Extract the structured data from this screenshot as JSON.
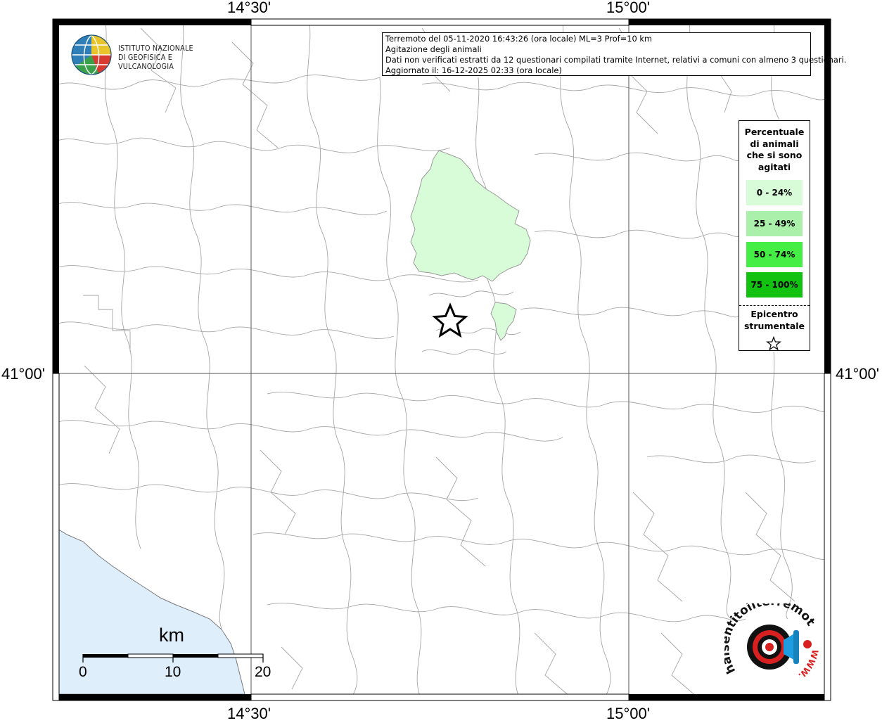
{
  "map": {
    "top_labels": [
      "14°30'",
      "15°00'"
    ],
    "bottom_labels": [
      "14°30'",
      "15°00'"
    ],
    "left_label": "41°00'",
    "right_label": "41°00'",
    "colors": {
      "land": "#ffffff",
      "sea": "#dfeefb",
      "boundary": "#a0a0a0",
      "class_0_24": "#d8fbd8",
      "class_25_49": "#aaf0aa",
      "class_50_74": "#44ee44",
      "class_75_100": "#11c211"
    }
  },
  "title_box": {
    "line1": "Terremoto del 05-11-2020 16:43:26 (ora locale) ML=3 Prof=10 km",
    "line2": "Agitazione degli animali",
    "line3": "Dati non verificati estratti da 12 questionari compilati tramite Internet, relativi a comuni con almeno 3 questionari.",
    "line4": "Aggiornato il: 16-12-2025 02:33 (ora locale)"
  },
  "logo": {
    "line1": "ISTITUTO NAZIONALE",
    "line2": "DI GEOFISICA E VULCANOLOGIA"
  },
  "legend": {
    "title_lines": [
      "Percentuale",
      "di animali",
      "che si sono",
      "agitati"
    ],
    "items": [
      "0 - 24%",
      "25 - 49%",
      "50 - 74%",
      "75 - 100%"
    ],
    "epicenter_lines": [
      "Epicentro",
      "strumentale"
    ],
    "epicenter_icon": "star-outline-icon"
  },
  "scale_bar": {
    "unit": "km",
    "ticks": [
      "0",
      "10",
      "20"
    ]
  },
  "watermark": {
    "text": "haisentitoilterremoto.it",
    "url_text": "WWW.",
    "icon": "target-megaphone-icon"
  }
}
